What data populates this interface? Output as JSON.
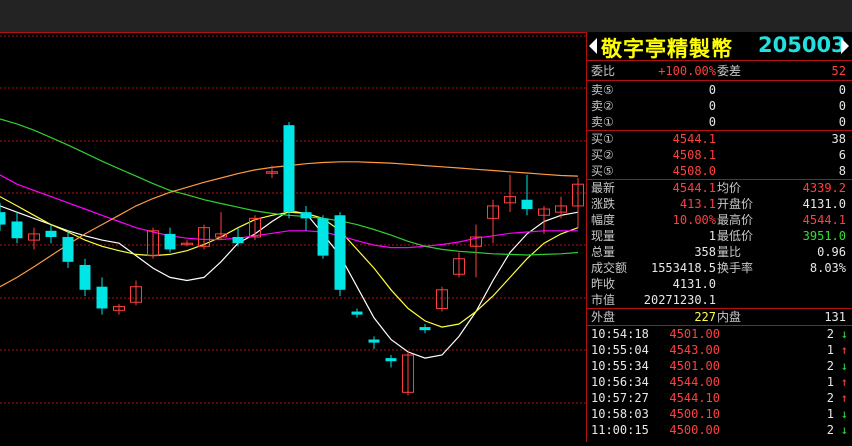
{
  "colors": {
    "up": "#ff4040",
    "down": "#00e5e5",
    "ma1": "#ffffff",
    "ma2": "#ffff40",
    "ma3": "#ff00ff",
    "ma4": "#30d030",
    "ma5": "#ff9a40",
    "grid": "#b01010"
  },
  "stock": {
    "name": "敬字亭精製幣",
    "code": "205003"
  },
  "order": {
    "committee_ratio_label": "委比",
    "committee_ratio": "+100.00%",
    "committee_diff_label": "委差",
    "committee_diff": "52"
  },
  "sell": [
    {
      "label": "卖⑤",
      "price": "0",
      "vol": "0"
    },
    {
      "label": "卖②",
      "price": "0",
      "vol": "0"
    },
    {
      "label": "卖①",
      "price": "0",
      "vol": "0"
    }
  ],
  "buy": [
    {
      "label": "买①",
      "price": "4544.1",
      "vol": "38"
    },
    {
      "label": "买②",
      "price": "4508.1",
      "vol": "6"
    },
    {
      "label": "买⑤",
      "price": "4508.0",
      "vol": "8"
    }
  ],
  "stats": [
    {
      "l1": "最新",
      "v1": "4544.1",
      "c1": "red",
      "l2": "均价",
      "v2": "4339.2",
      "c2": "red"
    },
    {
      "l1": "涨跌",
      "v1": "413.1",
      "c1": "red",
      "l2": "开盘价",
      "v2": "4131.0",
      "c2": "white"
    },
    {
      "l1": "幅度",
      "v1": "10.00%",
      "c1": "red",
      "l2": "最高价",
      "v2": "4544.1",
      "c2": "red"
    },
    {
      "l1": "现量",
      "v1": "1",
      "c1": "white",
      "l2": "最低价",
      "v2": "3951.0",
      "c2": "green"
    },
    {
      "l1": "总量",
      "v1": "358",
      "c1": "white",
      "l2": "量比",
      "v2": "0.96",
      "c2": "white"
    },
    {
      "l1": "成交额",
      "v1": "1553418.5",
      "c1": "white",
      "l2": "换手率",
      "v2": "8.03%",
      "c2": "white"
    },
    {
      "l1": "昨收",
      "v1": "4131.0",
      "c1": "white",
      "l2": "",
      "v2": "",
      "c2": "white"
    },
    {
      "l1": "市值",
      "v1": "20271230.1",
      "c1": "white",
      "l2": "",
      "v2": "",
      "c2": "white"
    }
  ],
  "outer": {
    "label": "外盘",
    "value": "227"
  },
  "inner": {
    "label": "内盘",
    "value": "131"
  },
  "ticks": [
    {
      "time": "10:54:18",
      "price": "4501.00",
      "vol": "2",
      "dir": "down"
    },
    {
      "time": "10:55:04",
      "price": "4543.00",
      "vol": "1",
      "dir": "up"
    },
    {
      "time": "10:55:34",
      "price": "4501.00",
      "vol": "2",
      "dir": "down"
    },
    {
      "time": "10:56:34",
      "price": "4544.00",
      "vol": "1",
      "dir": "up"
    },
    {
      "time": "10:57:27",
      "price": "4544.10",
      "vol": "2",
      "dir": "up"
    },
    {
      "time": "10:58:03",
      "price": "4500.10",
      "vol": "1",
      "dir": "down"
    },
    {
      "time": "11:00:15",
      "price": "4500.00",
      "vol": "2",
      "dir": "down"
    }
  ],
  "chart_data": {
    "type": "candlestick",
    "candles": [
      {
        "o": 4150,
        "h": 4165,
        "l": 4120,
        "c": 4130
      },
      {
        "o": 4135,
        "h": 4150,
        "l": 4100,
        "c": 4108
      },
      {
        "o": 4105,
        "h": 4125,
        "l": 4090,
        "c": 4115
      },
      {
        "o": 4120,
        "h": 4130,
        "l": 4100,
        "c": 4110
      },
      {
        "o": 4110,
        "h": 4120,
        "l": 4060,
        "c": 4070
      },
      {
        "o": 4065,
        "h": 4075,
        "l": 4015,
        "c": 4025
      },
      {
        "o": 4030,
        "h": 4045,
        "l": 3985,
        "c": 3995
      },
      {
        "o": 3992,
        "h": 4002,
        "l": 3985,
        "c": 3998
      },
      {
        "o": 4005,
        "h": 4040,
        "l": 4000,
        "c": 4030
      },
      {
        "o": 4080,
        "h": 4125,
        "l": 4075,
        "c": 4120
      },
      {
        "o": 4115,
        "h": 4125,
        "l": 4085,
        "c": 4090
      },
      {
        "o": 4100,
        "h": 4105,
        "l": 4095,
        "c": 4100
      },
      {
        "o": 4095,
        "h": 4130,
        "l": 4090,
        "c": 4125
      },
      {
        "o": 4110,
        "h": 4150,
        "l": 4105,
        "c": 4115
      },
      {
        "o": 4110,
        "h": 4125,
        "l": 4095,
        "c": 4100
      },
      {
        "o": 4110,
        "h": 4145,
        "l": 4105,
        "c": 4140
      },
      {
        "o": 4215,
        "h": 4225,
        "l": 4205,
        "c": 4215
      },
      {
        "o": 4290,
        "h": 4295,
        "l": 4140,
        "c": 4150
      },
      {
        "o": 4150,
        "h": 4160,
        "l": 4120,
        "c": 4140
      },
      {
        "o": 4140,
        "h": 4145,
        "l": 4075,
        "c": 4080
      },
      {
        "o": 4145,
        "h": 4150,
        "l": 4015,
        "c": 4025
      },
      {
        "o": 3990,
        "h": 3995,
        "l": 3980,
        "c": 3985
      },
      {
        "o": 3945,
        "h": 3950,
        "l": 3930,
        "c": 3940
      },
      {
        "o": 3915,
        "h": 3920,
        "l": 3900,
        "c": 3910
      },
      {
        "o": 3860,
        "h": 3925,
        "l": 3855,
        "c": 3920
      },
      {
        "o": 3965,
        "h": 3970,
        "l": 3955,
        "c": 3960
      },
      {
        "o": 3995,
        "h": 4030,
        "l": 3990,
        "c": 4025
      },
      {
        "o": 4050,
        "h": 4085,
        "l": 4045,
        "c": 4075
      },
      {
        "o": 4095,
        "h": 4130,
        "l": 4045,
        "c": 4110
      },
      {
        "o": 4140,
        "h": 4170,
        "l": 4100,
        "c": 4160
      },
      {
        "o": 4165,
        "h": 4210,
        "l": 4150,
        "c": 4175
      },
      {
        "o": 4170,
        "h": 4210,
        "l": 4145,
        "c": 4155
      },
      {
        "o": 4145,
        "h": 4160,
        "l": 4115,
        "c": 4155
      },
      {
        "o": 4150,
        "h": 4175,
        "l": 4140,
        "c": 4160
      },
      {
        "o": 4160,
        "h": 4205,
        "l": 4125,
        "c": 4195
      }
    ],
    "ma": [
      {
        "name": "MA1",
        "color": "#ffffff",
        "values": [
          4160,
          4150,
          4140,
          4130,
          4120,
          4112,
          4105,
          4100,
          4080,
          4060,
          4045,
          4040,
          4045,
          4070,
          4100,
          4115,
          4135,
          4152,
          4148,
          4115,
          4080,
          4030,
          3980,
          3945,
          3925,
          3915,
          3920,
          3950,
          3990,
          4040,
          4085,
          4115,
          4135,
          4145,
          4150
        ]
      },
      {
        "name": "MA2",
        "color": "#ffff40",
        "values": [
          4175,
          4160,
          4145,
          4130,
          4118,
          4105,
          4095,
          4088,
          4082,
          4080,
          4082,
          4088,
          4098,
          4110,
          4125,
          4138,
          4145,
          4150,
          4148,
          4140,
          4120,
          4090,
          4060,
          4025,
          3995,
          3975,
          3965,
          3970,
          3990,
          4015,
          4045,
          4075,
          4100,
          4115,
          4125
        ]
      },
      {
        "name": "MA3",
        "color": "#ff00ff",
        "values": [
          4210,
          4195,
          4185,
          4175,
          4165,
          4155,
          4145,
          4135,
          4125,
          4118,
          4112,
          4108,
          4106,
          4106,
          4108,
          4112,
          4116,
          4120,
          4120,
          4118,
          4112,
          4104,
          4097,
          4093,
          4093,
          4095,
          4098,
          4102,
          4108,
          4112,
          4116,
          4118,
          4120,
          4120,
          4120
        ]
      },
      {
        "name": "MA4",
        "color": "#30d030",
        "values": [
          4300,
          4292,
          4282,
          4270,
          4258,
          4245,
          4232,
          4220,
          4208,
          4196,
          4185,
          4178,
          4170,
          4164,
          4158,
          4152,
          4148,
          4145,
          4143,
          4140,
          4136,
          4130,
          4122,
          4113,
          4103,
          4095,
          4090,
          4087,
          4085,
          4083,
          4082,
          4081,
          4082,
          4083,
          4085
        ]
      },
      {
        "name": "MA5",
        "color": "#ff9a40",
        "values": [
          4030,
          4045,
          4062,
          4080,
          4098,
          4115,
          4130,
          4145,
          4160,
          4172,
          4182,
          4190,
          4198,
          4205,
          4212,
          4218,
          4222,
          4225,
          4228,
          4230,
          4231,
          4231,
          4230,
          4229,
          4227,
          4225,
          4223,
          4221,
          4219,
          4217,
          4215,
          4213,
          4211,
          4209,
          4208
        ]
      }
    ],
    "ylim": [
      3780,
      4440
    ],
    "grid": true
  }
}
